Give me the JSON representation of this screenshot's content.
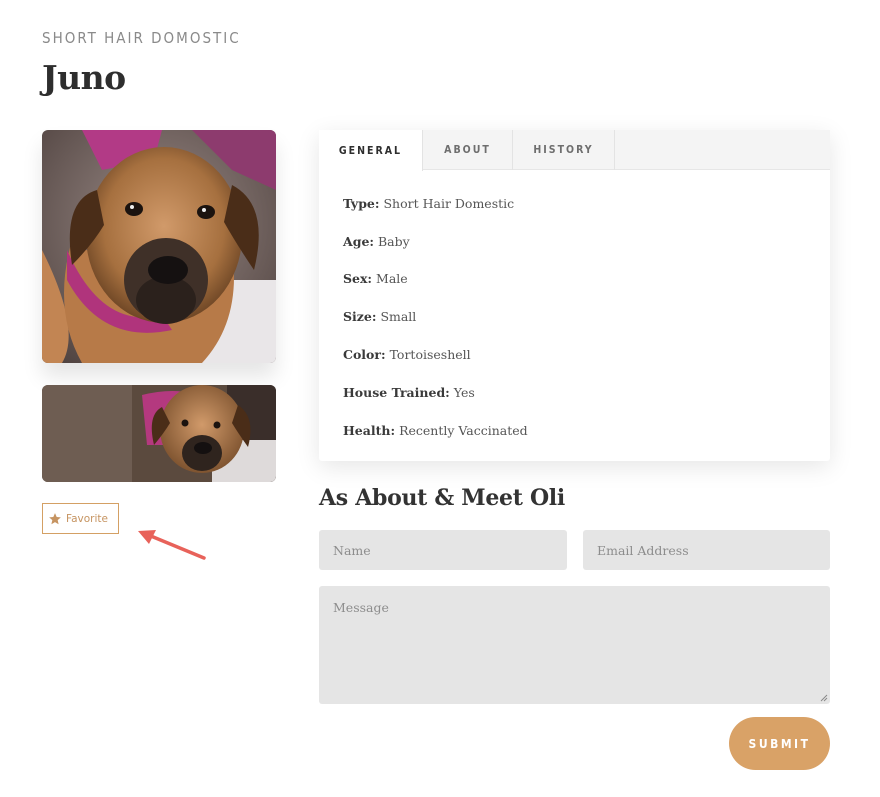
{
  "pet": {
    "category": "SHORT HAIR DOMOSTIC",
    "name": "Juno"
  },
  "gallery": {
    "main_photo": "dog-photo",
    "thumb_photo": "dog-photo"
  },
  "favorite": {
    "icon": "star-icon",
    "label": "Favorite"
  },
  "tabs": [
    {
      "label": "GENERAL",
      "active": true
    },
    {
      "label": "ABOUT",
      "active": false
    },
    {
      "label": "HISTORY",
      "active": false
    }
  ],
  "details": [
    {
      "key": "Type:",
      "value": "Short Hair Domestic"
    },
    {
      "key": "Age:",
      "value": "Baby"
    },
    {
      "key": "Sex:",
      "value": "Male"
    },
    {
      "key": "Size:",
      "value": "Small"
    },
    {
      "key": "Color:",
      "value": "Tortoiseshell"
    },
    {
      "key": "House Trained:",
      "value": "Yes"
    },
    {
      "key": "Health:",
      "value": "Recently Vaccinated"
    }
  ],
  "form": {
    "title": "As About & Meet Oli",
    "name_placeholder": "Name",
    "email_placeholder": "Email Address",
    "message_placeholder": "Message",
    "submit_label": "SUBMIT"
  },
  "colors": {
    "accent": "#d9a267",
    "annotation_arrow": "#e8625a",
    "field_bg": "#e5e5e5"
  }
}
